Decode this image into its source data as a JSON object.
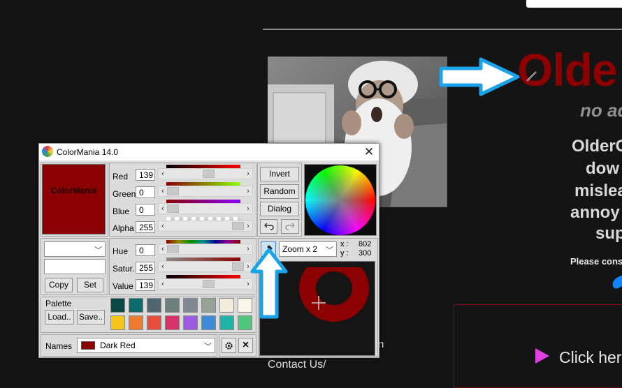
{
  "website": {
    "title": "Olde",
    "subtitle": "no ad",
    "paragraph_lines": [
      "OlderG",
      "dow",
      "mislea",
      "annoy",
      "sup"
    ],
    "please_text": "Please cons",
    "click_text": "Click her",
    "footer_fragment": "n",
    "contact_link": "Contact Us/",
    "accent_color": "#8b0000",
    "callout_color": "#1aa3e8"
  },
  "colormania": {
    "window_title": "ColorMania 14.0",
    "close_glyph": "✕",
    "preview": {
      "label": "ColorMania",
      "color": "#8b0000"
    },
    "rgb": [
      {
        "label": "Red",
        "value": "139",
        "fraction": 0.545
      },
      {
        "label": "Green",
        "value": "0",
        "fraction": 0
      },
      {
        "label": "Blue",
        "value": "0",
        "fraction": 0
      },
      {
        "label": "Alpha",
        "value": "255",
        "fraction": 1
      }
    ],
    "hsv": [
      {
        "label": "Hue",
        "value": "0",
        "fraction": 0
      },
      {
        "label": "Satur.",
        "value": "255",
        "fraction": 1
      },
      {
        "label": "Value",
        "value": "139",
        "fraction": 0.545
      }
    ],
    "buttons": {
      "invert": "Invert",
      "random": "Random",
      "dialog": "Dialog",
      "undo_icon": "undo-icon",
      "redo_icon": "redo-icon",
      "copy": "Copy",
      "set": "Set",
      "load": "Load..",
      "save": "Save.."
    },
    "format_select_value": "",
    "hex_input_value": "",
    "palette_label": "Palette",
    "palette_colors": [
      "#0a4a45",
      "#0d6b6e",
      "#4f6570",
      "#6a7f7e",
      "#7f8893",
      "#96a497",
      "#f3ecdc",
      "#fbf6ea",
      "#f5c518",
      "#ef7b2e",
      "#e84c3d",
      "#d6336c",
      "#9b59e6",
      "#3d8bd8",
      "#1eb5a8",
      "#4fc77a"
    ],
    "zoom": {
      "select_value": "Zoom x 2",
      "x_label": "x :",
      "x_value": "802",
      "y_label": "y :",
      "y_value": "300"
    },
    "names": {
      "label": "Names",
      "selected": "Dark Red",
      "swatch_color": "#8b0000"
    },
    "settings_icon": "gear-icon",
    "delete_glyph": "✕"
  }
}
